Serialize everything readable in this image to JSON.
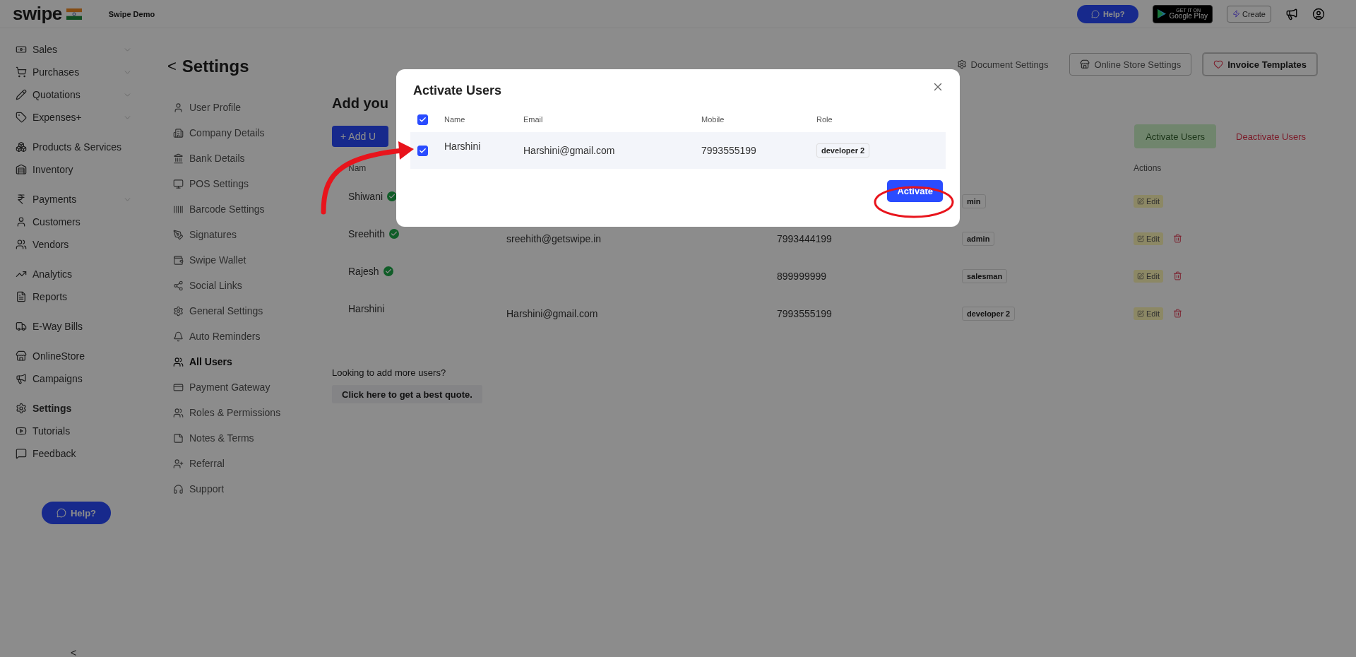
{
  "topbar": {
    "logo": "swipe",
    "company": "Swipe Demo",
    "help": "Help?",
    "store_badge": {
      "small": "GET IT ON",
      "large": "Google Play"
    },
    "create": "Create"
  },
  "sidebar": {
    "groups": [
      {
        "items": [
          {
            "label": "Sales",
            "selected": false,
            "expandable": true
          },
          {
            "label": "Purchases",
            "selected": false,
            "expandable": true
          },
          {
            "label": "Quotations",
            "selected": false,
            "expandable": true
          },
          {
            "label": "Expenses+",
            "selected": false,
            "expandable": true
          }
        ]
      },
      {
        "items": [
          {
            "label": "Products & Services",
            "selected": false,
            "expandable": false
          },
          {
            "label": "Inventory",
            "selected": false,
            "expandable": false
          }
        ]
      },
      {
        "items": [
          {
            "label": "Payments",
            "selected": false,
            "expandable": true
          },
          {
            "label": "Customers",
            "selected": false,
            "expandable": false
          },
          {
            "label": "Vendors",
            "selected": false,
            "expandable": false
          }
        ]
      },
      {
        "items": [
          {
            "label": "Analytics",
            "selected": false,
            "expandable": false
          },
          {
            "label": "Reports",
            "selected": false,
            "expandable": false
          }
        ]
      },
      {
        "items": [
          {
            "label": "E-Way Bills",
            "selected": false,
            "expandable": false
          }
        ]
      },
      {
        "items": [
          {
            "label": "OnlineStore",
            "selected": false,
            "expandable": false
          },
          {
            "label": "Campaigns",
            "selected": false,
            "expandable": false
          }
        ]
      },
      {
        "items": [
          {
            "label": "Settings",
            "selected": true,
            "expandable": false
          },
          {
            "label": "Tutorials",
            "selected": false,
            "expandable": false
          },
          {
            "label": "Feedback",
            "selected": false,
            "expandable": false
          }
        ]
      }
    ],
    "help": "Help?",
    "collapse": "<"
  },
  "settings_nav": {
    "back": "<",
    "title": "Settings",
    "items": [
      {
        "label": "User Profile",
        "selected": false
      },
      {
        "label": "Company Details",
        "selected": false
      },
      {
        "label": "Bank Details",
        "selected": false
      },
      {
        "label": "POS Settings",
        "selected": false
      },
      {
        "label": "Barcode Settings",
        "selected": false
      },
      {
        "label": "Signatures",
        "selected": false
      },
      {
        "label": "Swipe Wallet",
        "selected": false
      },
      {
        "label": "Social Links",
        "selected": false
      },
      {
        "label": "General Settings",
        "selected": false
      },
      {
        "label": "Auto Reminders",
        "selected": false
      },
      {
        "label": "All Users",
        "selected": true
      },
      {
        "label": "Payment Gateway",
        "selected": false
      },
      {
        "label": "Roles & Permissions",
        "selected": false
      },
      {
        "label": "Notes & Terms",
        "selected": false
      },
      {
        "label": "Referral",
        "selected": false
      },
      {
        "label": "Support",
        "selected": false
      }
    ]
  },
  "main": {
    "header_links": [
      {
        "kind": "link",
        "label": "Document Settings"
      },
      {
        "kind": "button",
        "label": "Online Store Settings"
      },
      {
        "kind": "primary",
        "label": "Invoice Templates"
      }
    ],
    "title": "Add you",
    "add_button": "+ Add U",
    "activate_button": "Activate Users",
    "deactivate_button": "Deactivate Users",
    "table": {
      "header": {
        "name": "Nam",
        "actions": "Actions"
      },
      "rows": [
        {
          "name": "Shiwani",
          "verified": true,
          "role": "min",
          "edit": "Edit",
          "deletable": false
        },
        {
          "name": "Sreehith",
          "verified": true,
          "email": "sreehith@getswipe.in",
          "mobile": "7993444199",
          "role": "admin",
          "edit": "Edit",
          "deletable": true
        },
        {
          "name": "Rajesh",
          "verified": true,
          "mobile": "899999999",
          "role": "salesman",
          "edit": "Edit",
          "deletable": true
        },
        {
          "name": "Harshini",
          "verified": false,
          "email": "Harshini@gmail.com",
          "mobile": "7993555199",
          "role": "developer 2",
          "edit": "Edit",
          "deletable": true
        }
      ]
    },
    "more_users": "Looking to add more users?",
    "quote_button": "Click here to get a best quote."
  },
  "modal": {
    "title": "Activate Users",
    "select_all": {
      "checked": true
    },
    "columns": [
      "Name",
      "Email",
      "Mobile",
      "Role"
    ],
    "rows": [
      {
        "checked": true,
        "name": "Harshini",
        "email": "Harshini@gmail.com",
        "mobile": "7993555199",
        "role": "developer 2"
      }
    ],
    "action": "Activate"
  }
}
